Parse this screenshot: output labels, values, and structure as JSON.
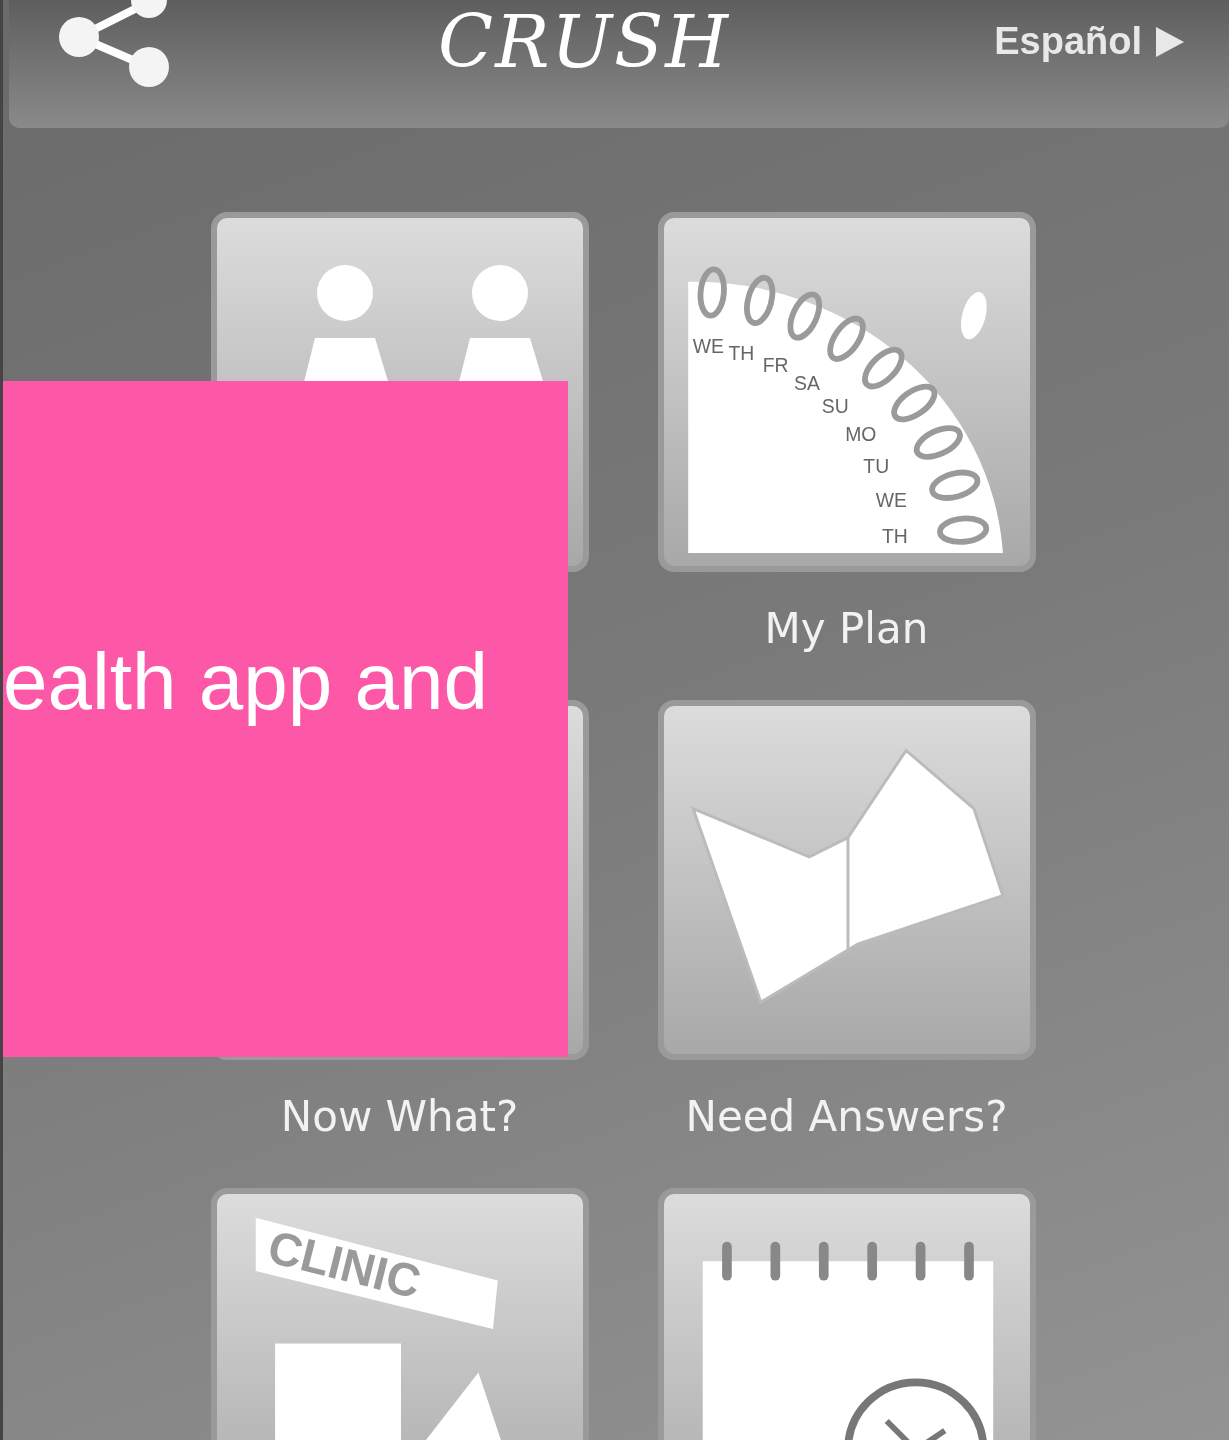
{
  "header": {
    "logo": "CRUSH",
    "language_button": "Español"
  },
  "tiles": [
    {
      "kind": "couple"
    },
    {
      "kind": "plan",
      "label": "My Plan",
      "day_labels": [
        "WE",
        "TH",
        "FR",
        "SA",
        "SU",
        "MO",
        "TU",
        "WE",
        "TH"
      ]
    },
    {
      "kind": "blank",
      "label": "Now What?"
    },
    {
      "kind": "book",
      "label": "Need Answers?"
    },
    {
      "kind": "clinic",
      "sign": "CLINIC"
    },
    {
      "kind": "calendar"
    }
  ],
  "overlay": {
    "text": "ealth app and"
  }
}
